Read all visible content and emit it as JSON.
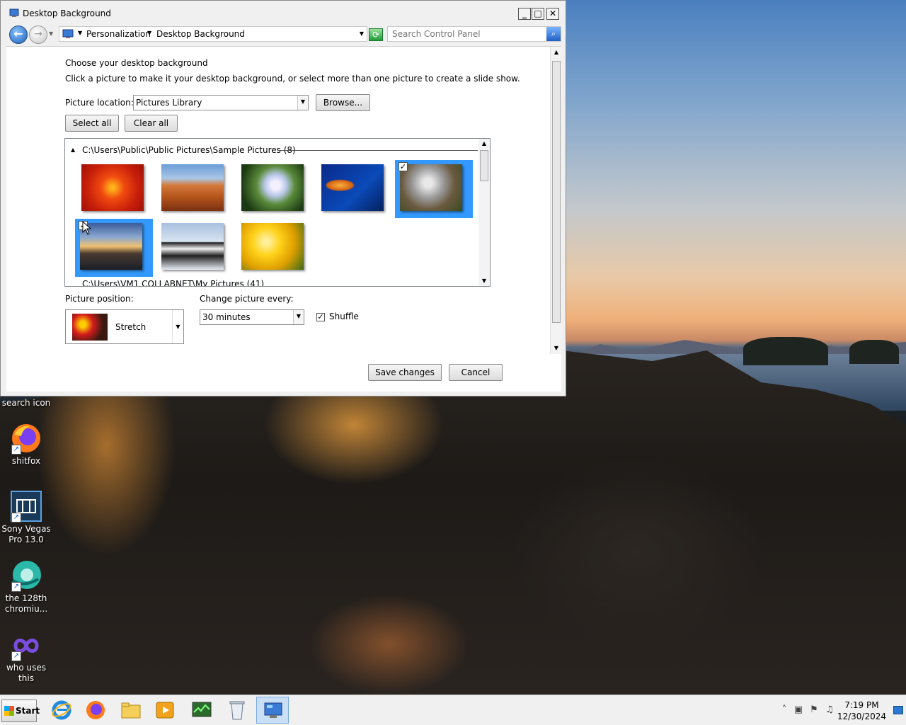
{
  "window": {
    "title": "Desktop Background",
    "minimize": "_",
    "maximize": "□",
    "close": "✕"
  },
  "navigation": {
    "breadcrumbs": [
      "Personalization",
      "Desktop Background"
    ],
    "search_placeholder": "Search Control Panel"
  },
  "content": {
    "heading": "Choose your desktop background",
    "subheading": "Click a picture to make it your desktop background, or select more than one picture to create a slide show.",
    "picture_location_label": "Picture location:",
    "picture_location_value": "Pictures Library",
    "browse_label": "Browse...",
    "select_all_label": "Select all",
    "clear_all_label": "Clear all",
    "gallery": {
      "group_header": "C:\\Users\\Public\\Public Pictures\\Sample Pictures (8)",
      "group2_header": "C:\\Users\\VM1 COLLABNET\\My Pictures (41)",
      "images": [
        {
          "name": "chrysanthemum",
          "checked": false,
          "selected": false
        },
        {
          "name": "desert",
          "checked": false,
          "selected": false
        },
        {
          "name": "hydrangeas",
          "checked": false,
          "selected": false
        },
        {
          "name": "jellyfish",
          "checked": false,
          "selected": false
        },
        {
          "name": "koala",
          "checked": true,
          "selected": true
        },
        {
          "name": "lighthouse",
          "checked": true,
          "selected": true
        },
        {
          "name": "penguins",
          "checked": false,
          "selected": false
        },
        {
          "name": "tulips",
          "checked": false,
          "selected": false
        }
      ]
    },
    "picture_position_label": "Picture position:",
    "picture_position_value": "Stretch",
    "change_every_label": "Change picture every:",
    "change_every_value": "30 minutes",
    "shuffle_label": "Shuffle",
    "shuffle_checked": true,
    "save_label": "Save changes",
    "cancel_label": "Cancel"
  },
  "desktop_icons": [
    {
      "label": "search icon",
      "icon": "search-icon"
    },
    {
      "label": "shitfox",
      "icon": "firefox-icon"
    },
    {
      "label": "Sony Vegas Pro 13.0",
      "icon": "film-icon"
    },
    {
      "label": "the 128th chromiu...",
      "icon": "chromium-icon"
    },
    {
      "label": "who uses this",
      "icon": "infinity-icon"
    }
  ],
  "taskbar": {
    "start_label": "Start",
    "pinned": [
      "internet-explorer-icon",
      "firefox-icon",
      "file-explorer-icon",
      "media-player-icon",
      "task-manager-icon",
      "recycle-bin-icon",
      "control-panel-icon"
    ],
    "time": "7:19 PM",
    "date": "12/30/2024"
  }
}
